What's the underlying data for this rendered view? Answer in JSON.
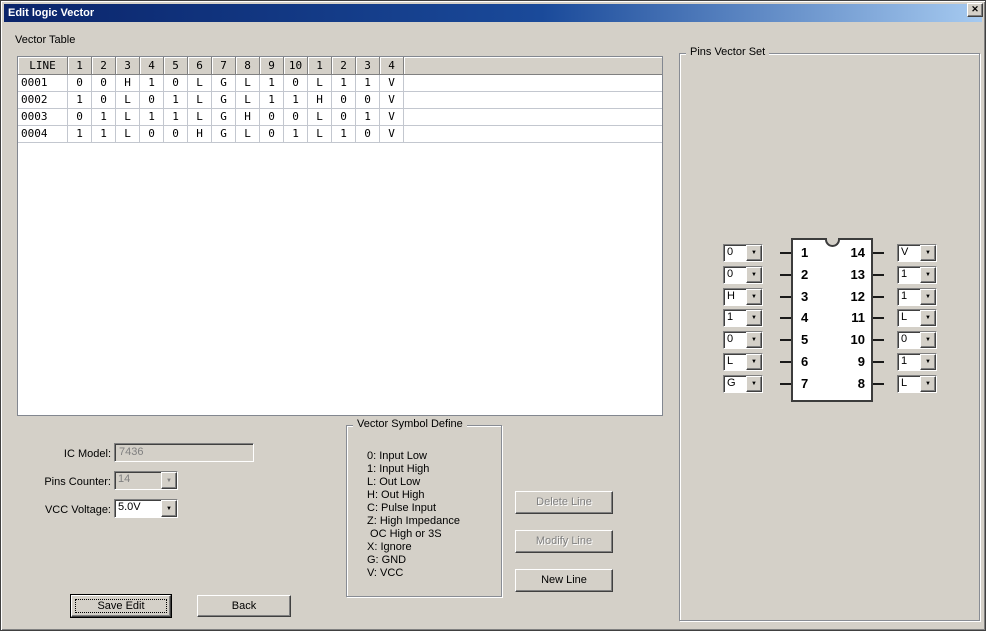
{
  "window": {
    "title": "Edit logic Vector"
  },
  "icons": {
    "close": "✕",
    "dropdown_arrow": "▼"
  },
  "vector_table": {
    "group_label": "Vector Table",
    "headers": [
      "LINE",
      "1",
      "2",
      "3",
      "4",
      "5",
      "6",
      "7",
      "8",
      "9",
      "10",
      "1",
      "2",
      "3",
      "4"
    ],
    "rows": [
      {
        "line": "0001",
        "values": [
          "0",
          "0",
          "H",
          "1",
          "0",
          "L",
          "G",
          "L",
          "1",
          "0",
          "L",
          "1",
          "1",
          "V"
        ]
      },
      {
        "line": "0002",
        "values": [
          "1",
          "0",
          "L",
          "0",
          "1",
          "L",
          "G",
          "L",
          "1",
          "1",
          "H",
          "0",
          "0",
          "V"
        ]
      },
      {
        "line": "0003",
        "values": [
          "0",
          "1",
          "L",
          "1",
          "1",
          "L",
          "G",
          "H",
          "0",
          "0",
          "L",
          "0",
          "1",
          "V"
        ]
      },
      {
        "line": "0004",
        "values": [
          "1",
          "1",
          "L",
          "0",
          "0",
          "H",
          "G",
          "L",
          "0",
          "1",
          "L",
          "1",
          "0",
          "V"
        ]
      }
    ]
  },
  "ic_info": {
    "ic_model_label": "IC Model:",
    "ic_model_value": "7436",
    "pins_counter_label": "Pins Counter:",
    "pins_counter_value": "14",
    "vcc_voltage_label": "VCC Voltage:",
    "vcc_voltage_value": "5.0V"
  },
  "symbol_define": {
    "group_label": "Vector Symbol Define",
    "lines": [
      "0: Input Low",
      "1: Input High",
      "L: Out Low",
      "H: Out High",
      "C: Pulse Input",
      "Z: High Impedance",
      " OC High or 3S",
      "X: Ignore",
      "G: GND",
      "V: VCC"
    ]
  },
  "buttons": {
    "delete_line": "Delete Line",
    "modify_line": "Modify Line",
    "new_line": "New Line",
    "save_edit": "Save Edit",
    "back": "Back"
  },
  "pins_vector_set": {
    "group_label": "Pins Vector Set",
    "left_pins": [
      {
        "pin": "1",
        "value": "0"
      },
      {
        "pin": "2",
        "value": "0"
      },
      {
        "pin": "3",
        "value": "H"
      },
      {
        "pin": "4",
        "value": "1"
      },
      {
        "pin": "5",
        "value": "0"
      },
      {
        "pin": "6",
        "value": "L"
      },
      {
        "pin": "7",
        "value": "G"
      }
    ],
    "right_pins": [
      {
        "pin": "14",
        "value": "V"
      },
      {
        "pin": "13",
        "value": "1"
      },
      {
        "pin": "12",
        "value": "1"
      },
      {
        "pin": "11",
        "value": "L"
      },
      {
        "pin": "10",
        "value": "0"
      },
      {
        "pin": "9",
        "value": "1"
      },
      {
        "pin": "8",
        "value": "L"
      }
    ]
  }
}
